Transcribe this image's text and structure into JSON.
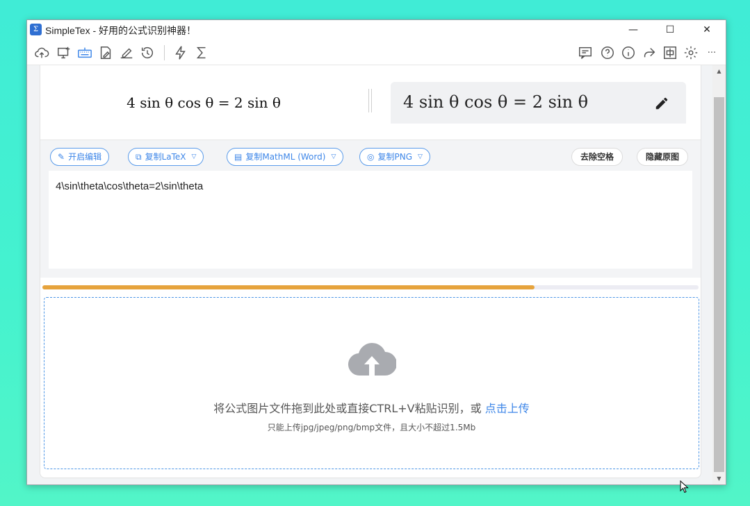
{
  "window": {
    "title": "SimpleTex - 好用的公式识别神器！",
    "app_icon_glyph": "Σ",
    "controls": {
      "minimize": "—",
      "maximize": "☐",
      "close": "✕"
    }
  },
  "toolbar": {
    "left_icons": [
      "cloud-upload-icon",
      "screen-capture-icon",
      "keyboard-icon",
      "edit-document-icon",
      "handwrite-icon",
      "history-icon"
    ],
    "mid_icons": [
      "lightning-icon",
      "sigma-icon"
    ],
    "right_icons": [
      "chat-icon",
      "help-icon",
      "info-icon",
      "share-icon",
      "language-icon",
      "settings-icon",
      "more-icon"
    ],
    "more_label": "···",
    "language_label": "中"
  },
  "preview": {
    "rendered_left": "4 sin θ cos θ = 2 sin θ",
    "rendered_right": "4 sin θ cos θ = 2 sin θ"
  },
  "actions": {
    "start_edit": "开启编辑",
    "copy_latex": "复制LaTeX",
    "copy_mathml": "复制MathML (Word)",
    "copy_png": "复制PNG",
    "remove_spaces": "去除空格",
    "hide_original": "隐藏原图"
  },
  "editor": {
    "latex_value": "4\\sin\\theta\\cos\\theta=2\\sin\\theta"
  },
  "progress": {
    "fraction": 0.75,
    "color": "#e6a33c"
  },
  "dropzone": {
    "main_text": "将公式图片文件拖到此处或直接CTRL+V粘贴识别，或",
    "upload_link": "点击上传",
    "sub_text": "只能上传jpg/jpeg/png/bmp文件，且大小不超过1.5Mb"
  },
  "colors": {
    "accent_blue": "#3d86e8",
    "background_teal": "#44f2cf"
  }
}
